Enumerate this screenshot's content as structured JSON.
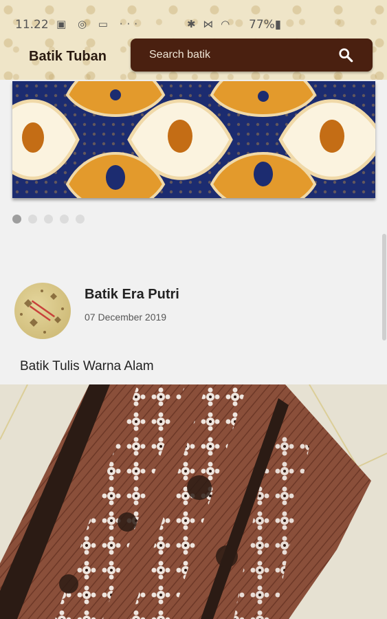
{
  "status_bar": {
    "time": "11.22",
    "left_icons": "▣ ◎ ▭ ···",
    "right_icons": "✱ ⋈ ◠",
    "battery": "77%▮"
  },
  "header": {
    "app_title": "Batik Tuban",
    "search_placeholder": "Search batik"
  },
  "carousel": {
    "total_slides": 5,
    "active_index": 0
  },
  "post": {
    "shop_name": "Batik Era Putri",
    "date": "07 December 2019",
    "title": "Batik Tulis Warna Alam"
  },
  "colors": {
    "search_bg": "#4a2010",
    "header_bg": "#efe5c8",
    "page_bg": "#f1f1f1",
    "dot_active": "#9e9e9e",
    "dot_inactive": "#dcdcdc"
  }
}
